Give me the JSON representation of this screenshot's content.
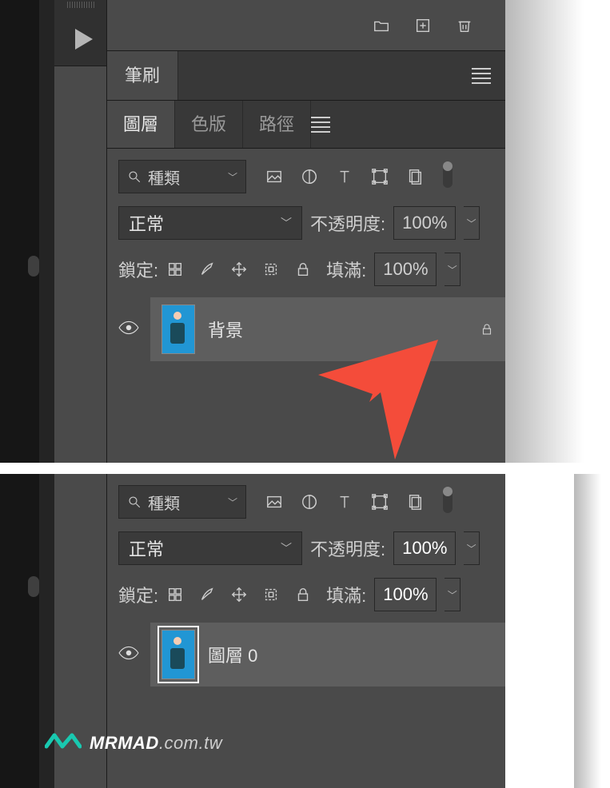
{
  "brush": {
    "tab_label": "筆刷"
  },
  "tabs": {
    "layers": "圖層",
    "channels": "色版",
    "paths": "路徑"
  },
  "filter": {
    "search_label": "種類"
  },
  "blend": {
    "mode": "正常",
    "opacity_label": "不透明度:",
    "opacity_value": "100%"
  },
  "lock": {
    "label": "鎖定:",
    "fill_label": "填滿:",
    "fill_value": "100%"
  },
  "layerA": {
    "name": "背景"
  },
  "layerB": {
    "name": "圖層 0"
  },
  "watermark": {
    "bold": "MRMAD",
    "rest": ".com.tw"
  }
}
